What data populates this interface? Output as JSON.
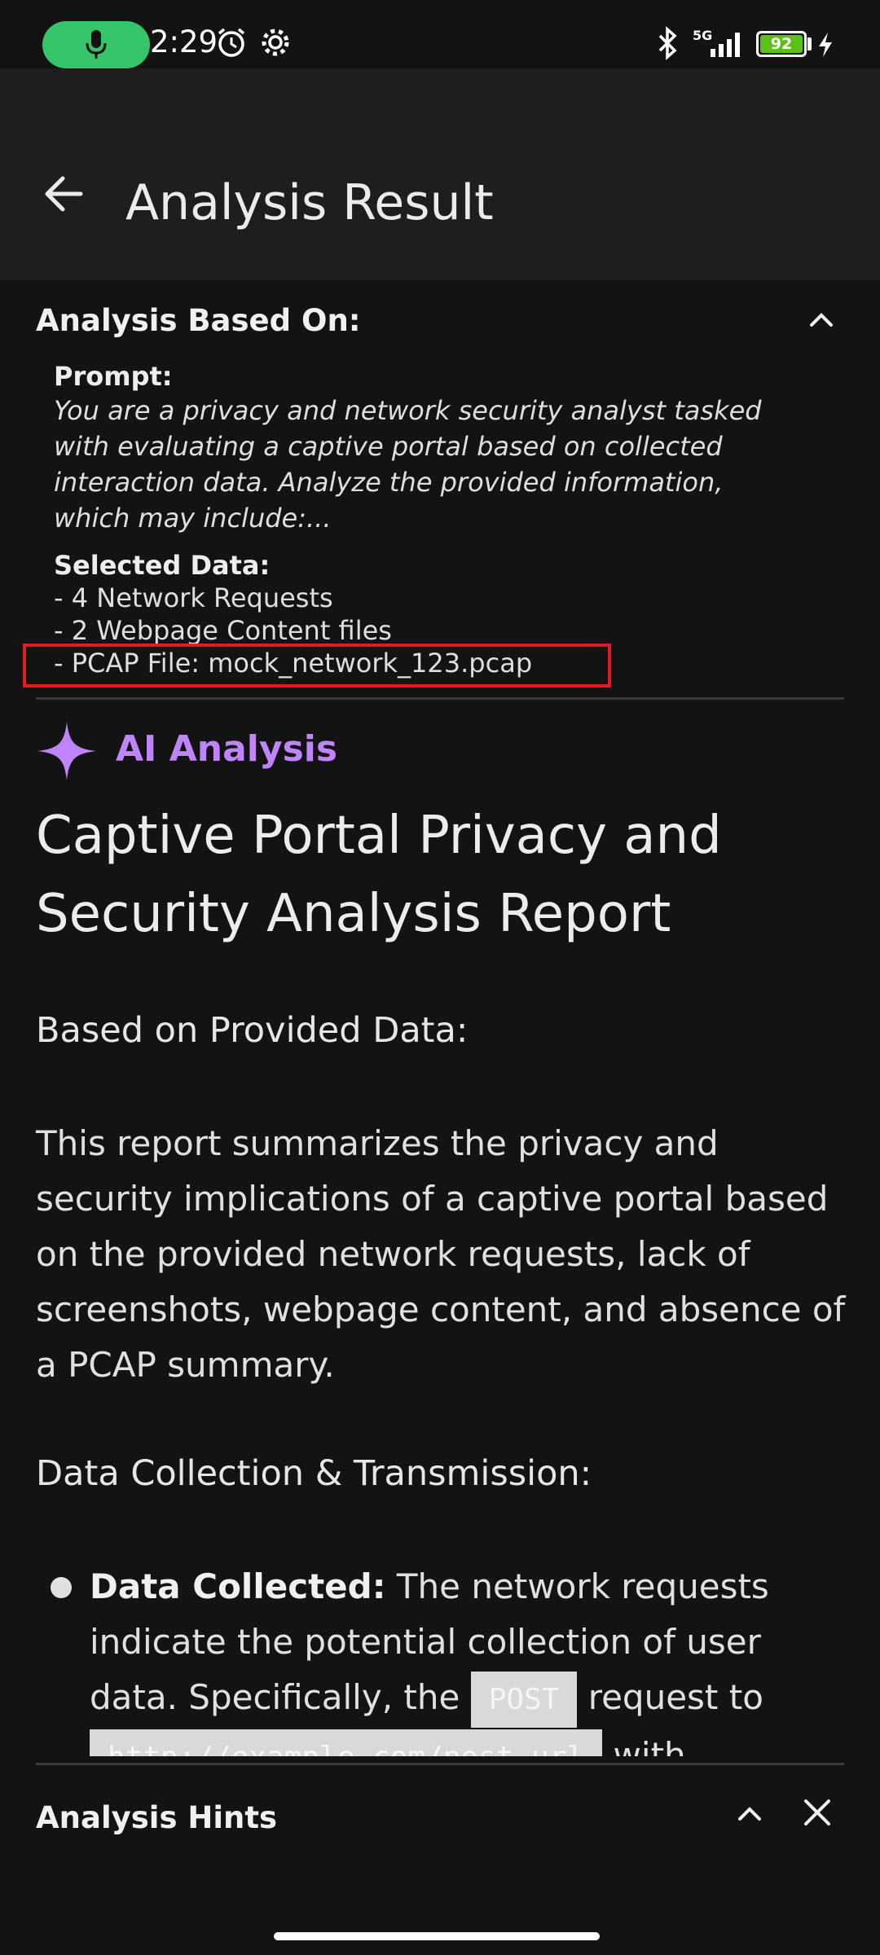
{
  "status_bar": {
    "time": "2:29",
    "battery": "92",
    "network": "5G"
  },
  "app_bar": {
    "title": "Analysis Result"
  },
  "analysis_based_on": {
    "title": "Analysis Based On:",
    "prompt_label": "Prompt:",
    "prompt_lines": [
      "You are a privacy and network security analyst tasked",
      "with evaluating a captive portal based on collected",
      "interaction data. Analyze the provided information,",
      "which may include:..."
    ],
    "selected_label": "Selected Data:",
    "selected_items": [
      "- 4 Network Requests",
      "- 2 Webpage Content files",
      "- PCAP File: mock_network_123.pcap"
    ]
  },
  "ai_analysis": {
    "label": "AI Analysis",
    "accent_color": "#c084fc",
    "report_title": "Captive Portal Privacy and Security Analysis Report",
    "section_based": "Based on Provided Data:",
    "intro_paragraph": "This report summarizes the privacy and security implications of a captive portal based on the provided network requests, lack of screenshots, webpage content, and absence of a PCAP summary.",
    "section_collection": "Data Collection & Transmission:",
    "bullet": {
      "term": "Data Collected:",
      "text_1": " The network requests indicate the potential collection of user data. Specifically, the ",
      "code_1": "POST",
      "text_2": " request to ",
      "code_2": "http://example.com/post_url",
      "text_3": " with"
    }
  },
  "hints": {
    "title": "Analysis Hints"
  },
  "colors": {
    "background": "#131314",
    "app_bar": "#1e1e1f",
    "highlight_border": "#e31b23",
    "mic_pill": "#35c46a",
    "battery": "#5cc01b"
  }
}
